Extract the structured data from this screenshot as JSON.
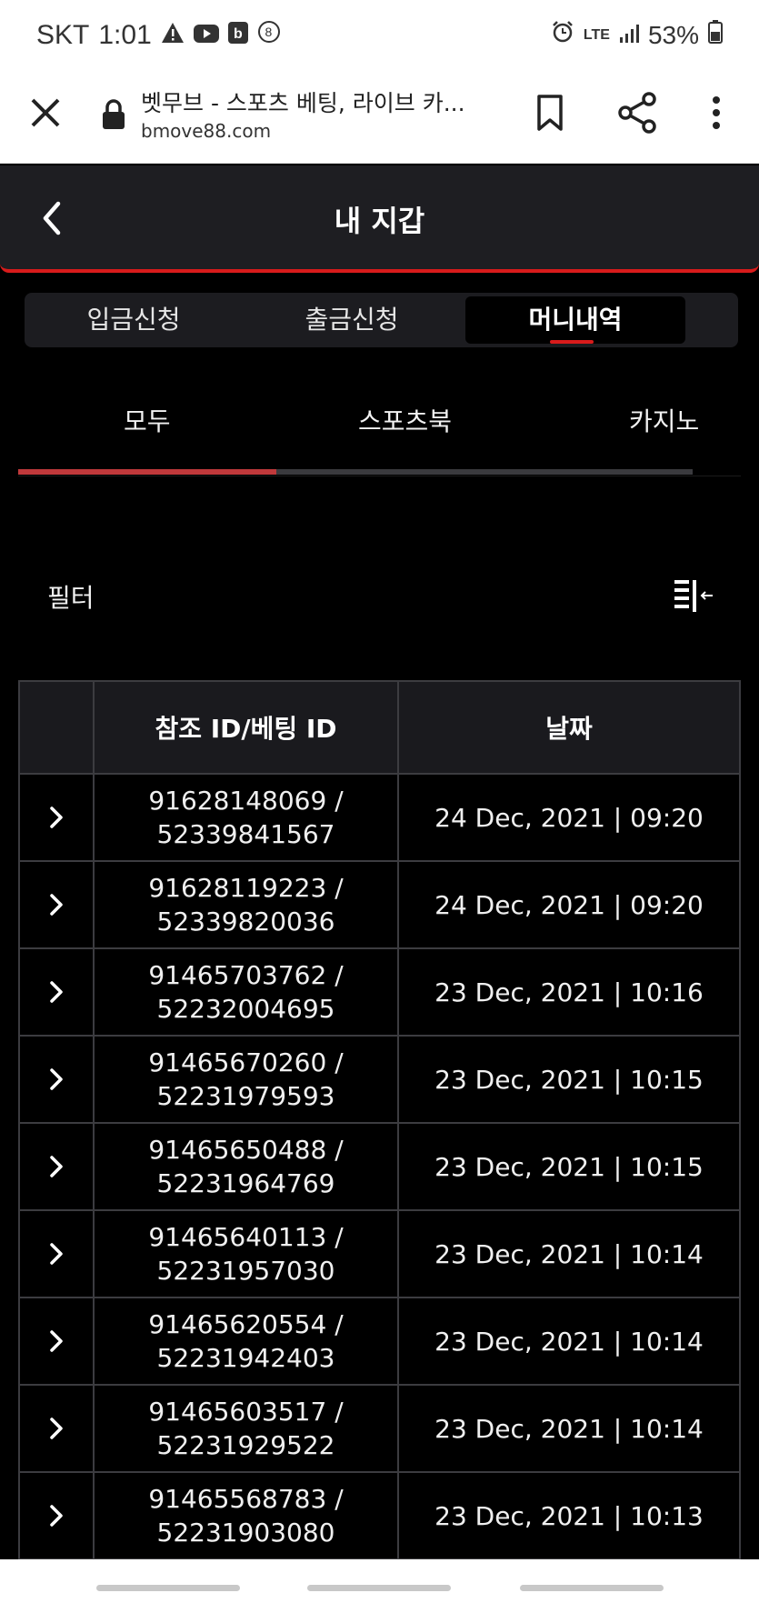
{
  "status_bar": {
    "carrier": "SKT",
    "time": "1:01",
    "network": "LTE",
    "battery": "53%"
  },
  "browser": {
    "title": "벳무브 - 스포츠 베팅, 라이브 카...",
    "url": "bmove88.com"
  },
  "header": {
    "title": "내 지갑"
  },
  "segment_tabs": [
    {
      "label": "입금신청",
      "active": false
    },
    {
      "label": "출금신청",
      "active": false
    },
    {
      "label": "머니내역",
      "active": true
    }
  ],
  "category_tabs": [
    {
      "label": "모두",
      "active": true
    },
    {
      "label": "스포츠북",
      "active": false
    },
    {
      "label": "카지노",
      "active": false
    }
  ],
  "filter": {
    "label": "필터"
  },
  "table": {
    "headers": [
      "",
      "참조 ID/베팅 ID",
      "날짜"
    ],
    "rows": [
      {
        "ref_id": "91628148069 /",
        "bet_id": "52339841567",
        "date": "24 Dec, 2021 | 09:20"
      },
      {
        "ref_id": "91628119223 /",
        "bet_id": "52339820036",
        "date": "24 Dec, 2021 | 09:20"
      },
      {
        "ref_id": "91465703762 /",
        "bet_id": "52232004695",
        "date": "23 Dec, 2021 | 10:16"
      },
      {
        "ref_id": "91465670260 /",
        "bet_id": "52231979593",
        "date": "23 Dec, 2021 | 10:15"
      },
      {
        "ref_id": "91465650488 /",
        "bet_id": "52231964769",
        "date": "23 Dec, 2021 | 10:15"
      },
      {
        "ref_id": "91465640113 /",
        "bet_id": "52231957030",
        "date": "23 Dec, 2021 | 10:14"
      },
      {
        "ref_id": "91465620554 /",
        "bet_id": "52231942403",
        "date": "23 Dec, 2021 | 10:14"
      },
      {
        "ref_id": "91465603517 /",
        "bet_id": "52231929522",
        "date": "23 Dec, 2021 | 10:14"
      },
      {
        "ref_id": "91465568783 /",
        "bet_id": "52231903080",
        "date": "23 Dec, 2021 | 10:13"
      }
    ]
  },
  "colors": {
    "accent": "#d81b1b",
    "background": "#000000",
    "header_bg": "#1e1e22"
  }
}
